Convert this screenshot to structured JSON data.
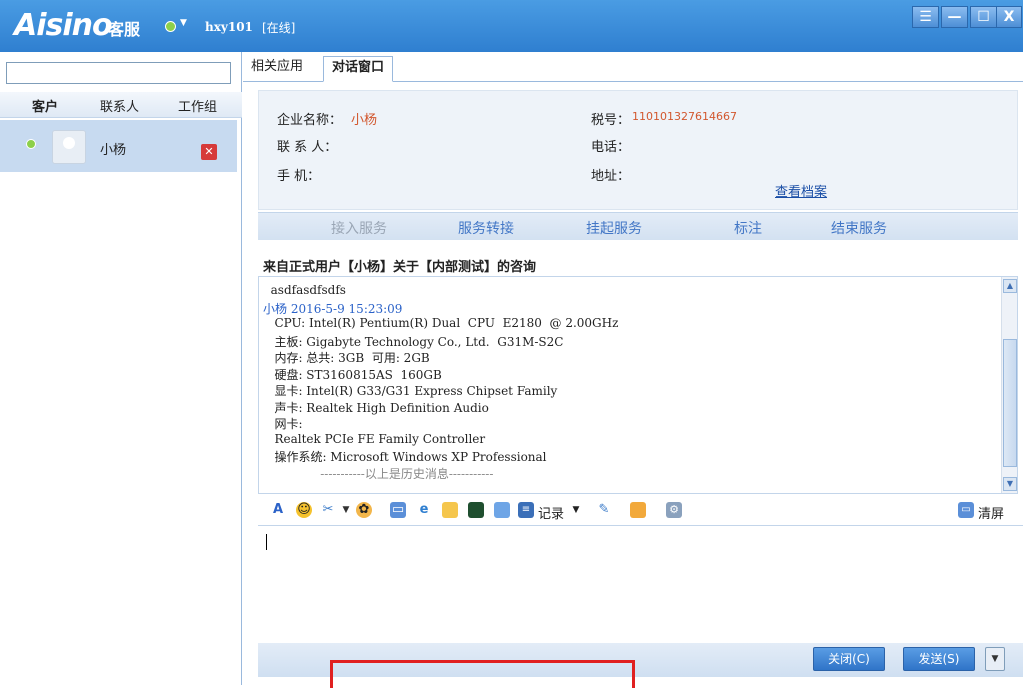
{
  "titlebar": {
    "logo": "Aisino",
    "logo_cn": "客服",
    "username": "hxy101",
    "status": "[在线]",
    "status_color": "#8dd04a"
  },
  "sidebar": {
    "tabs": [
      "客户",
      "联系人",
      "工作组"
    ],
    "contact_name": "小杨"
  },
  "main": {
    "tabs": [
      "相关应用",
      "对话窗口"
    ],
    "active_tab": "对话窗口",
    "info": {
      "company_label": "企业名称：",
      "company_value": "小杨",
      "tax_label": "税号：",
      "tax_value": "110101327614667",
      "contact_label": "联 系 人：",
      "phone_label": "电话：",
      "mobile_label": "手    机：",
      "address_label": "地址：",
      "view_archive": "查看档案"
    },
    "actions": [
      "接入服务",
      "服务转接",
      "挂起服务",
      "标注",
      "结束服务"
    ],
    "chat_title": "来自正式用户【小杨】关于【内部测试】的咨询",
    "chat_lines": [
      "  asdfasdfsdfs",
      "小杨 2016-5-9 15:23:09",
      "   CPU: Intel(R) Pentium(R) Dual  CPU  E2180  @ 2.00GHz",
      "   主板: Gigabyte Technology Co., Ltd.  G31M-S2C",
      "   内存: 总共: 3GB  可用: 2GB",
      "   硬盘: ST3160815AS  160GB",
      "   显卡: Intel(R) G33/G31 Express Chipset Family",
      "   声卡: Realtek High Definition Audio",
      "   网卡:",
      "   Realtek PCIe FE Family Controller",
      "   操作系统: Microsoft Windows XP Professional",
      "               -----------以上是历史消息-----------"
    ],
    "toolbar": {
      "record_label": "记录",
      "clear_label": "清屏"
    },
    "buttons": {
      "close": "关闭(C)",
      "send": "发送(S)"
    }
  }
}
